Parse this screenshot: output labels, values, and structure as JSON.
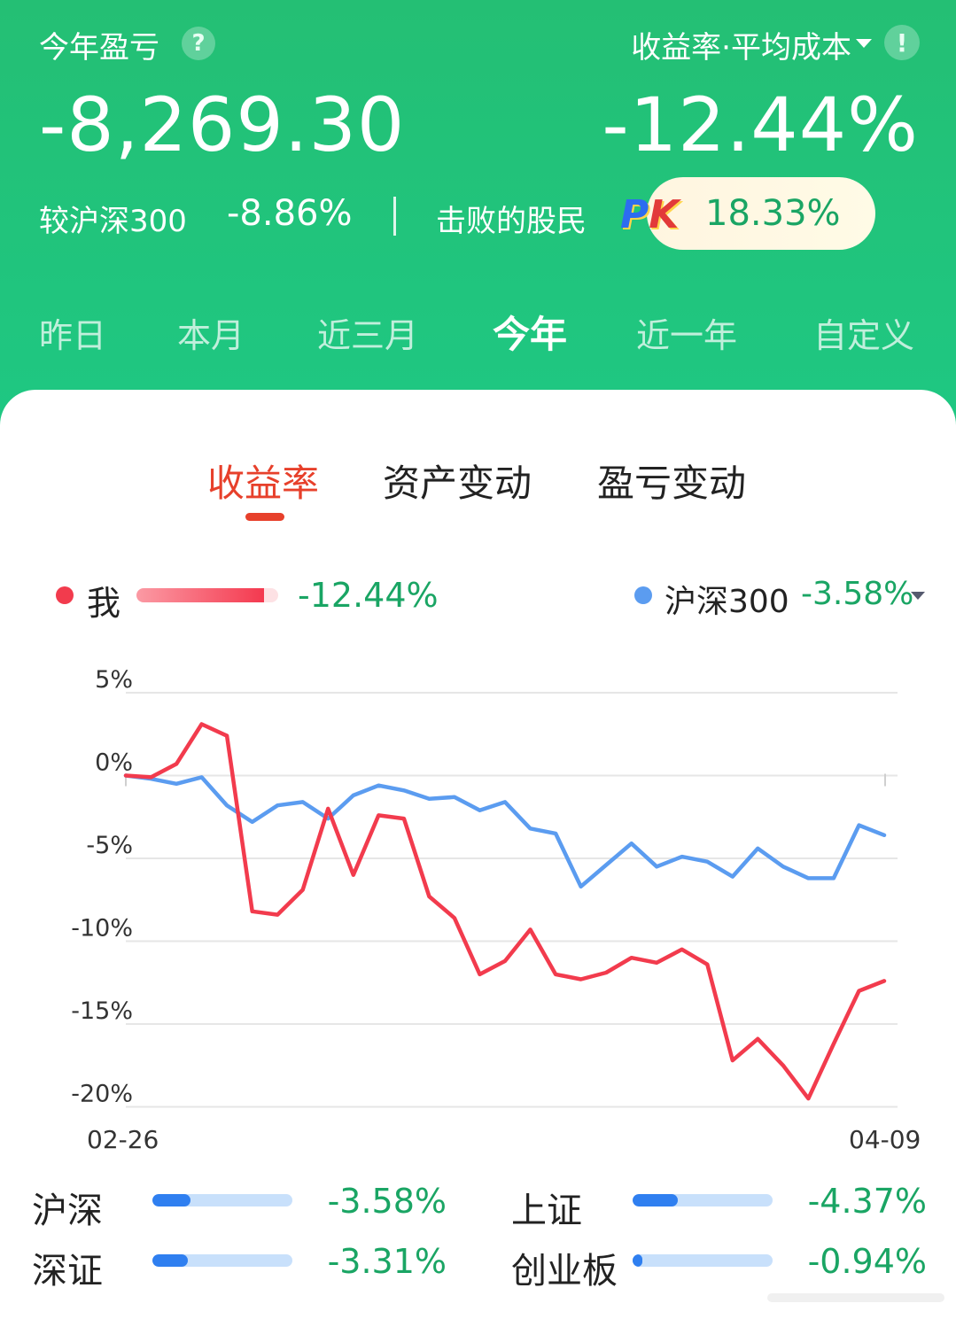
{
  "header": {
    "title": "今年盈亏",
    "question_icon": "question-icon",
    "rate_mode_label": "收益率·平均成本",
    "info_icon": "exclamation-icon",
    "pnl_amount": "-8,269.30",
    "return_rate": "-12.44%",
    "compare_label": "较沪深300",
    "compare_value": "-8.86%",
    "beat_label": "击败的股民",
    "pk_badge_p": "P",
    "pk_badge_k": "K",
    "beat_value": "18.33%"
  },
  "period_tabs": [
    "昨日",
    "本月",
    "近三月",
    "今年",
    "近一年",
    "自定义"
  ],
  "active_period": "今年",
  "sub_tabs": [
    "收益率",
    "资产变动",
    "盈亏变动"
  ],
  "active_sub_tab": "收益率",
  "legend": {
    "me_label": "我",
    "me_value": "-12.44%",
    "index_label": "沪深300",
    "index_value": "-3.58%"
  },
  "colors": {
    "header_green": "#22c27a",
    "me_red": "#f23b4d",
    "index_blue": "#5b9cf0",
    "down_green": "#1aa564",
    "active_tab_red": "#e7402b"
  },
  "chart_data": {
    "type": "line",
    "y_tick_labels": [
      "5%",
      "0%",
      "-5%",
      "-10%",
      "-15%",
      "-20%"
    ],
    "y_ticks": [
      5,
      0,
      -5,
      -10,
      -15,
      -20
    ],
    "ylim": [
      -20,
      5
    ],
    "x_start_label": "02-26",
    "x_end_label": "04-09",
    "grid": true,
    "series": [
      {
        "name": "我",
        "color": "#f23b4d",
        "values": [
          0,
          -0.1,
          0.7,
          3.1,
          2.4,
          -8.2,
          -8.4,
          -6.9,
          -2.0,
          -6.0,
          -2.4,
          -2.6,
          -7.3,
          -8.6,
          -12.0,
          -11.2,
          -9.3,
          -12.0,
          -12.3,
          -11.9,
          -11.0,
          -11.3,
          -10.5,
          -11.4,
          -17.2,
          -15.9,
          -17.5,
          -19.5,
          -16.2,
          -13.0,
          -12.4
        ]
      },
      {
        "name": "沪深300",
        "color": "#5b9cf0",
        "values": [
          0,
          -0.2,
          -0.5,
          -0.1,
          -1.8,
          -2.8,
          -1.8,
          -1.6,
          -2.6,
          -1.2,
          -0.6,
          -0.9,
          -1.4,
          -1.3,
          -2.1,
          -1.6,
          -3.2,
          -3.5,
          -6.7,
          -5.4,
          -4.1,
          -5.5,
          -4.9,
          -5.2,
          -6.1,
          -4.4,
          -5.5,
          -6.2,
          -6.2,
          -3.0,
          -3.6
        ]
      }
    ]
  },
  "indices": [
    {
      "name": "沪深",
      "value": "-3.58%",
      "bar_fraction": 0.27
    },
    {
      "name": "上证",
      "value": "-4.37%",
      "bar_fraction": 0.32
    },
    {
      "name": "深证",
      "value": "-3.31%",
      "bar_fraction": 0.25
    },
    {
      "name": "创业板",
      "value": "-0.94%",
      "bar_fraction": 0.07
    }
  ]
}
